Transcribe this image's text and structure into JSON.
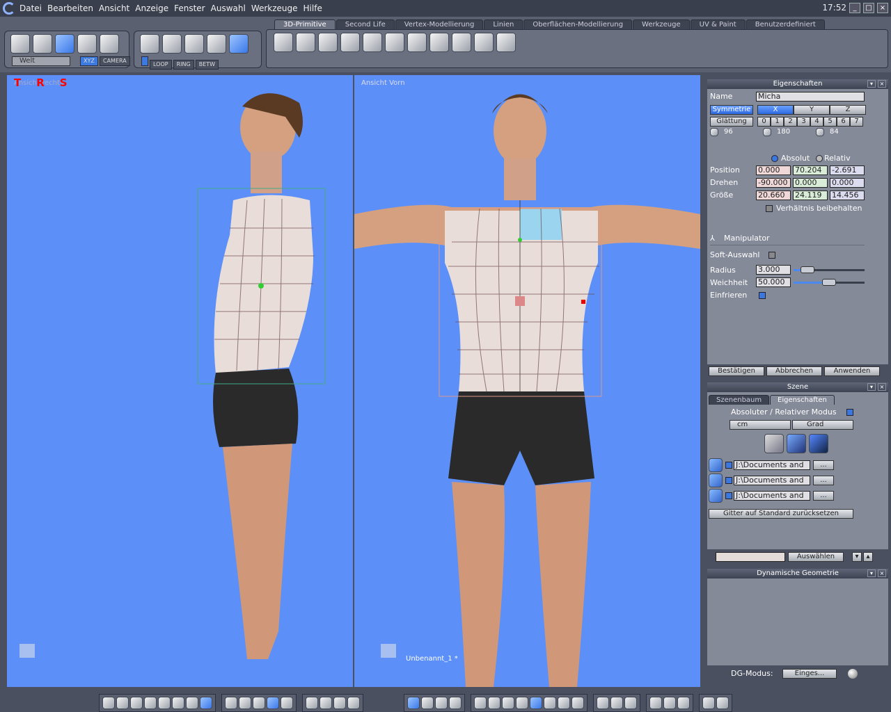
{
  "menubar": {
    "items": [
      "Datei",
      "Bearbeiten",
      "Ansicht",
      "Anzeige",
      "Fenster",
      "Auswahl",
      "Werkzeuge",
      "Hilfe"
    ],
    "clock": "17:52"
  },
  "toolbar": {
    "transform_icons": [
      "select-arrow-icon",
      "undo-arrow-icon",
      "tweak-tool-icon",
      "lasso-icon",
      "ghost-icon"
    ],
    "coord_dropdown": "Welt",
    "xyz_label": "XYZ",
    "camera_label": "CAMERA",
    "selection_icons": [
      "cube-vertex-icon",
      "cube-face-icon",
      "cube-edge-icon",
      "cube-point-icon",
      "cube-auto-icon"
    ],
    "select_buttons": [
      "LOOP",
      "RING",
      "BETW"
    ],
    "tabs": [
      "3D-Primitive",
      "Second Life",
      "Vertex-Modellierung",
      "Linien",
      "Oberflächen-Modellierung",
      "Werkzeuge",
      "UV & Paint",
      "Benutzerdefiniert"
    ],
    "active_tab": 0,
    "primitive_icons": [
      "cube-icon",
      "sphere-icon",
      "plane-icon",
      "grid-icon",
      "cylinder-icon",
      "cone-icon",
      "pyramid-icon",
      "diamond-icon",
      "dodecahedron-icon",
      "geosphere-icon",
      "text-icon"
    ]
  },
  "viewports": {
    "left": {
      "label": "Ansicht rechts",
      "trs": [
        "T",
        "R",
        "S"
      ]
    },
    "right": {
      "label": "Ansicht Vorn",
      "object_name": "Unbenannt_1 *"
    }
  },
  "properties": {
    "title": "Eigenschaften",
    "name_label": "Name",
    "name_value": "Micha",
    "symmetry_label": "Symmetrie",
    "axes": [
      "X",
      "Y",
      "Z"
    ],
    "smoothing_label": "Glättung",
    "levels": [
      "0",
      "1",
      "2",
      "3",
      "4",
      "5",
      "6",
      "7"
    ],
    "counts": [
      "96",
      "180",
      "84"
    ],
    "absolute_label": "Absolut",
    "relative_label": "Relativ",
    "rows": [
      {
        "label": "Position",
        "values": [
          "0.000",
          "70.204",
          "-2.691"
        ]
      },
      {
        "label": "Drehen",
        "values": [
          "-90.000",
          "0.000",
          "0.000"
        ]
      },
      {
        "label": "Größe",
        "values": [
          "20.660",
          "24.119",
          "14.456"
        ]
      }
    ],
    "keep_ratio_label": "Verhältnis beibehalten",
    "manipulator_label": "Manipulator",
    "soft_label": "Soft-Auswahl",
    "radius_label": "Radius",
    "radius_value": "3.000",
    "radius_slider": 0.2,
    "softness_label": "Weichheit",
    "softness_value": "50.000",
    "softness_slider": 0.5,
    "freeze_label": "Einfrieren",
    "buttons": [
      "Bestätigen",
      "Abbrechen",
      "Anwenden"
    ]
  },
  "scene": {
    "title": "Szene",
    "tabs": [
      "Szenenbaum",
      "Eigenschaften"
    ],
    "mode_label": "Absoluter / Relativer Modus",
    "unit": "cm",
    "angle": "Grad",
    "paths": [
      "J:\\Documents and",
      "J:\\Documents and",
      "J:\\Documents and"
    ],
    "browse": "...",
    "reset_label": "Gitter auf Standard zurücksetzen",
    "select_label": "Auswählen"
  },
  "dyngeo": {
    "title": "Dynamische Geometrie",
    "mode_label": "DG-Modus:",
    "mode_value": "Einges..."
  },
  "bottombar": {
    "groups": [
      [
        "single-view-icon",
        "quad-view-icon",
        "three-view-top-icon",
        "three-view-bottom-icon",
        "three-view-right-icon",
        "three-view-left-icon",
        "two-view-horizontal-icon",
        "two-view-vertical-icon"
      ],
      [
        "grid-snap-icon",
        "lock-icon",
        "grid-red-icon",
        "grid-blue-icon",
        "grid-green-icon"
      ],
      [
        "zoom-extents-icon",
        "pan-icon",
        "zoom-icon",
        "orbit-icon"
      ],
      [
        "axis-manipulator-icon",
        "move-icon",
        "rotate-icon",
        "scale-icon"
      ],
      [
        "wireframe-icon",
        "wireframe-shaded-icon",
        "flat-shaded-icon",
        "smooth-wire-icon",
        "smooth-shaded-icon",
        "xray-icon",
        "matte-sphere-icon",
        "shiny-sphere-icon"
      ],
      [
        "material-icon",
        "environment-icon",
        "lights-icon"
      ],
      [
        "cube-outline-icon",
        "cylinder-view-icon",
        "book-icon"
      ],
      [
        "render-icon",
        "camera-icon"
      ]
    ],
    "active": [
      7,
      3,
      null,
      0,
      4,
      null,
      null,
      null
    ]
  },
  "colors": {
    "viewport": "#5c90f8",
    "accent": "#3a78e0",
    "annotation": "#ff0000"
  }
}
